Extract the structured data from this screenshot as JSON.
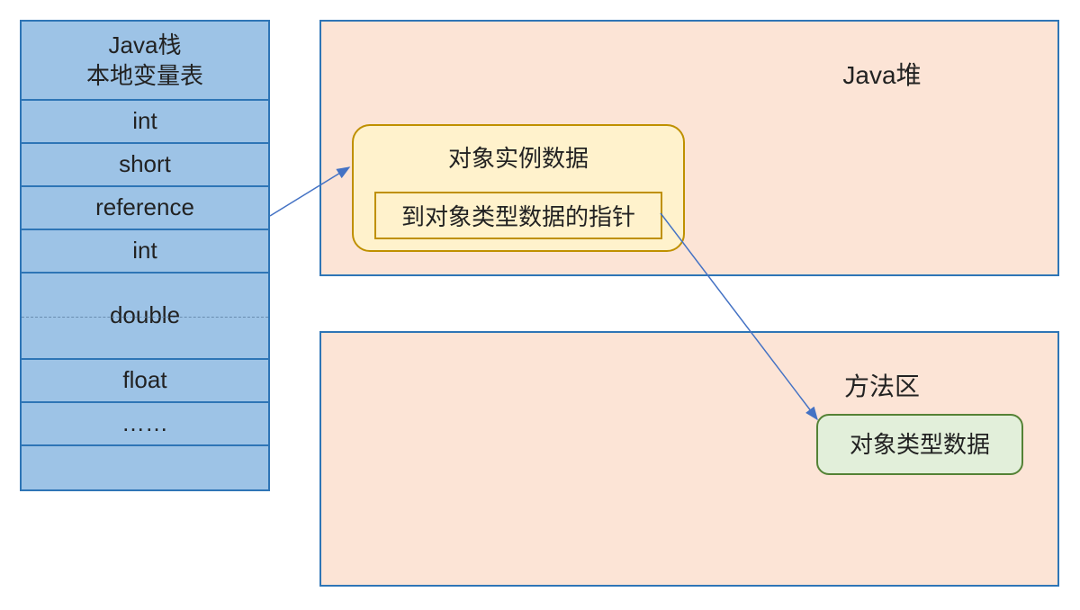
{
  "stack": {
    "title_line1": "Java栈",
    "title_line2": "本地变量表",
    "cells": [
      "int",
      "short",
      "reference",
      "int",
      "double",
      "float",
      "……",
      ""
    ]
  },
  "heap": {
    "title": "Java堆",
    "instance_title": "对象实例数据",
    "pointer_label": "到对象类型数据的指针"
  },
  "method_area": {
    "title": "方法区",
    "type_label": "对象类型数据"
  },
  "colors": {
    "stack_fill": "#9dc3e6",
    "stack_border": "#2e75b6",
    "panel_fill": "#fce4d6",
    "instance_fill": "#fff2cc",
    "instance_border": "#bf9000",
    "type_fill": "#e2efda",
    "type_border": "#548235",
    "arrow": "#4472c4"
  }
}
